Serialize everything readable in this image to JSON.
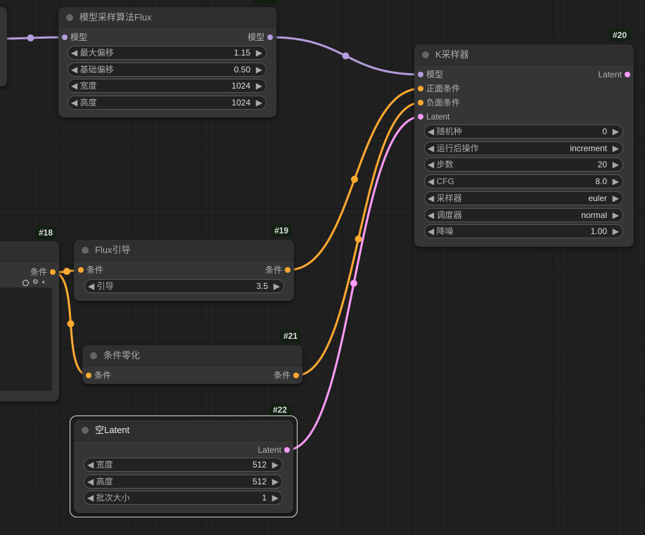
{
  "colors": {
    "model": "#b39ddb",
    "cond": "#ffa931",
    "latent": "#ff9cf9"
  },
  "icons": [
    "arrow-left-icon",
    "arrow-right-icon",
    "circle-icon",
    "gear-icon",
    "speaker-icon"
  ],
  "nodes": {
    "flux_sampling": {
      "title": "模型采样算法Flux",
      "in": "模型",
      "out": "模型",
      "widgets": [
        {
          "label": "最大偏移",
          "value": "1.15"
        },
        {
          "label": "基础偏移",
          "value": "0.50"
        },
        {
          "label": "宽度",
          "value": "1024"
        },
        {
          "label": "高度",
          "value": "1024"
        }
      ]
    },
    "ksampler": {
      "id": "#20",
      "title": "K采样器",
      "inputs": [
        "模型",
        "正面条件",
        "负面条件",
        "Latent"
      ],
      "out": "Latent",
      "widgets": [
        {
          "label": "随机种",
          "value": "0"
        },
        {
          "label": "运行后操作",
          "value": "increment"
        },
        {
          "label": "步数",
          "value": "20"
        },
        {
          "label": "CFG",
          "value": "8.0"
        },
        {
          "label": "采样器",
          "value": "euler"
        },
        {
          "label": "调度器",
          "value": "normal"
        },
        {
          "label": "降噪",
          "value": "1.00"
        }
      ]
    },
    "n18": {
      "id": "#18",
      "out": "条件"
    },
    "flux_guidance": {
      "id": "#19",
      "title": "Flux引导",
      "in": "条件",
      "out": "条件",
      "widgets": [
        {
          "label": "引导",
          "value": "3.5"
        }
      ]
    },
    "cond_zero": {
      "id": "#21",
      "title": "条件零化",
      "in": "条件",
      "out": "条件"
    },
    "empty_latent": {
      "id": "#22",
      "title": "空Latent",
      "out": "Latent",
      "widgets": [
        {
          "label": "宽度",
          "value": "512"
        },
        {
          "label": "高度",
          "value": "512"
        },
        {
          "label": "批次大小",
          "value": "1"
        }
      ]
    }
  }
}
